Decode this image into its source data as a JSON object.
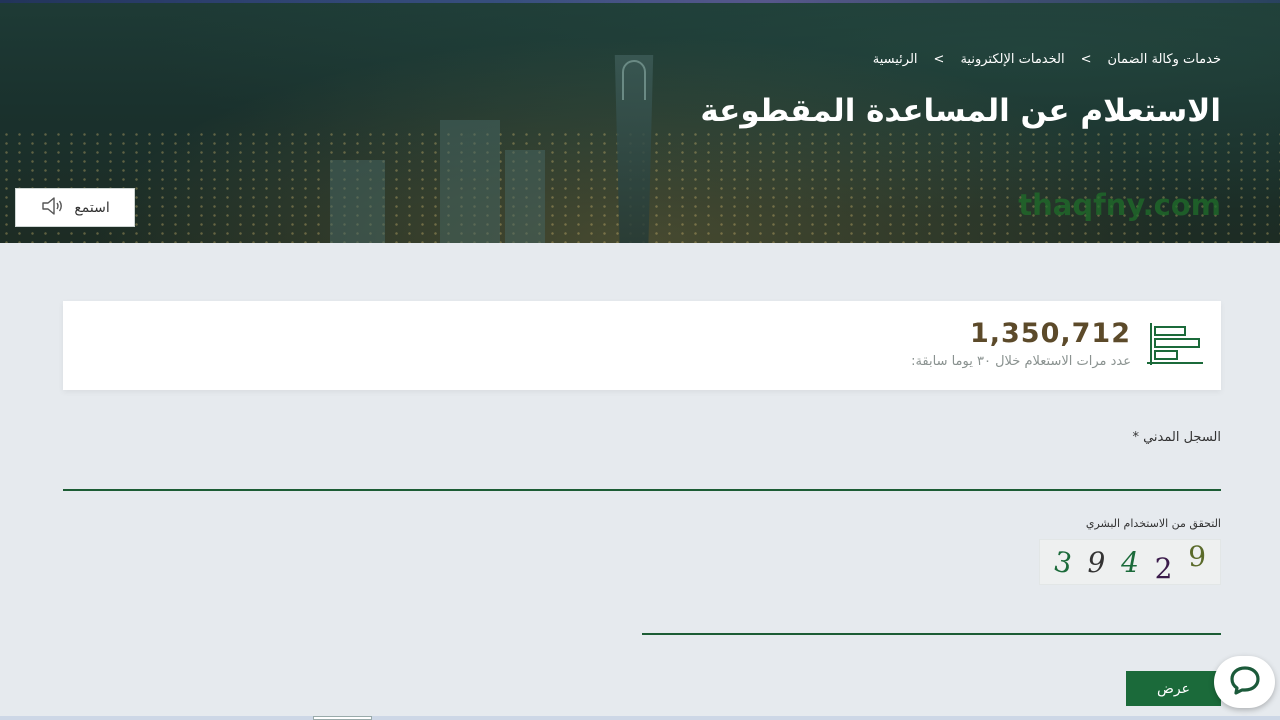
{
  "breadcrumb": {
    "home": "الرئيسية",
    "eservices": "الخدمات الإلكترونية",
    "current": "خدمات وكالة الضمان"
  },
  "page": {
    "title": "الاستعلام عن المساعدة المقطوعة",
    "watermark": "thaqfny.com"
  },
  "listen": {
    "label": "استمع",
    "icon": "speaker-icon"
  },
  "stats": {
    "count": "1,350,712",
    "label": "عدد مرات الاستعلام خلال ٣٠ يوما سابقة:",
    "icon": "bar-chart-icon"
  },
  "form": {
    "civil_record_label": "السجل المدني *",
    "civil_record_value": "",
    "captcha_label": "التحقق من الاستخدام البشري",
    "captcha_chars": [
      "9",
      "2",
      "4",
      "9",
      "3"
    ],
    "captcha_value": "",
    "submit_label": "عرض"
  },
  "chat": {
    "icon": "chat-bubble-icon"
  },
  "colors": {
    "primary_green": "#1b6a3a",
    "count_brown": "#5c4a2a",
    "page_bg": "#e6eaee"
  }
}
